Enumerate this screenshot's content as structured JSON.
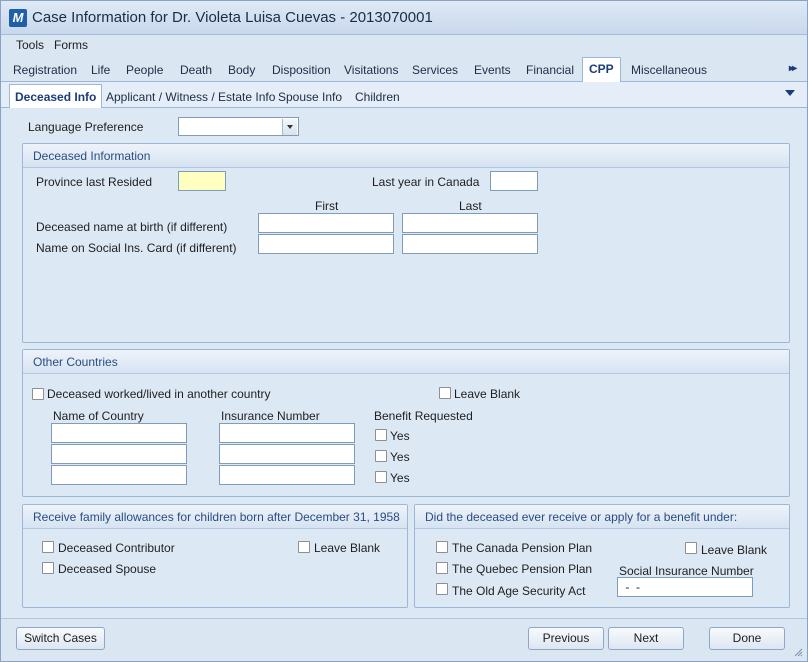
{
  "window": {
    "title": "Case Information for Dr. Violeta Luisa Cuevas - 2013070001",
    "app_icon_letter": "M"
  },
  "menu": [
    "Tools",
    "Forms"
  ],
  "main_tabs": [
    "Registration",
    "Life",
    "People",
    "Death",
    "Body",
    "Disposition",
    "Visitations",
    "Services",
    "Events",
    "Financial",
    "CPP",
    "Miscellaneous"
  ],
  "main_tabs_active": "CPP",
  "tabs_scroll_glyph": "▸▸",
  "sub_tabs": [
    "Deceased Info",
    "Applicant / Witness / Estate Info",
    "Spouse Info",
    "Children"
  ],
  "sub_tabs_active": "Deceased Info",
  "language": {
    "label": "Language Preference",
    "value": ""
  },
  "deceased_info": {
    "title": "Deceased Information",
    "province_label": "Province last Resided",
    "province_value": "",
    "last_year_label": "Last year in Canada",
    "last_year_value": "",
    "first_col": "First",
    "last_col": "Last",
    "birth_name_label": "Deceased name at birth (if different)",
    "sin_name_label": "Name on Social Ins. Card (if different)",
    "birth_first": "",
    "birth_last": "",
    "sin_first": "",
    "sin_last": ""
  },
  "other_countries": {
    "title": "Other Countries",
    "worked_label": "Deceased worked/lived in another country",
    "leave_blank_label": "Leave Blank",
    "country_col": "Name of Country",
    "insurance_col": "Insurance Number",
    "benefit_col": "Benefit Requested",
    "rows": [
      {
        "country": "",
        "insurance": "",
        "benefit_label": "Yes"
      },
      {
        "country": "",
        "insurance": "",
        "benefit_label": "Yes"
      },
      {
        "country": "",
        "insurance": "",
        "benefit_label": "Yes"
      }
    ]
  },
  "family_allowance": {
    "title": "Receive family allowances for children born after December 31, 1958",
    "contributor_label": "Deceased Contributor",
    "spouse_label": "Deceased Spouse",
    "leave_blank_label": "Leave Blank"
  },
  "benefits": {
    "title": "Did the deceased ever receive or apply for a benefit under:",
    "cpp_label": "The Canada Pension Plan",
    "qpp_label": "The Quebec Pension Plan",
    "oas_label": "The Old Age Security Act",
    "leave_blank_label": "Leave Blank",
    "sin_label": "Social Insurance Number",
    "sin_value": " -  -"
  },
  "buttons": {
    "switch_cases": "Switch Cases",
    "previous": "Previous",
    "next": "Next",
    "done": "Done"
  }
}
